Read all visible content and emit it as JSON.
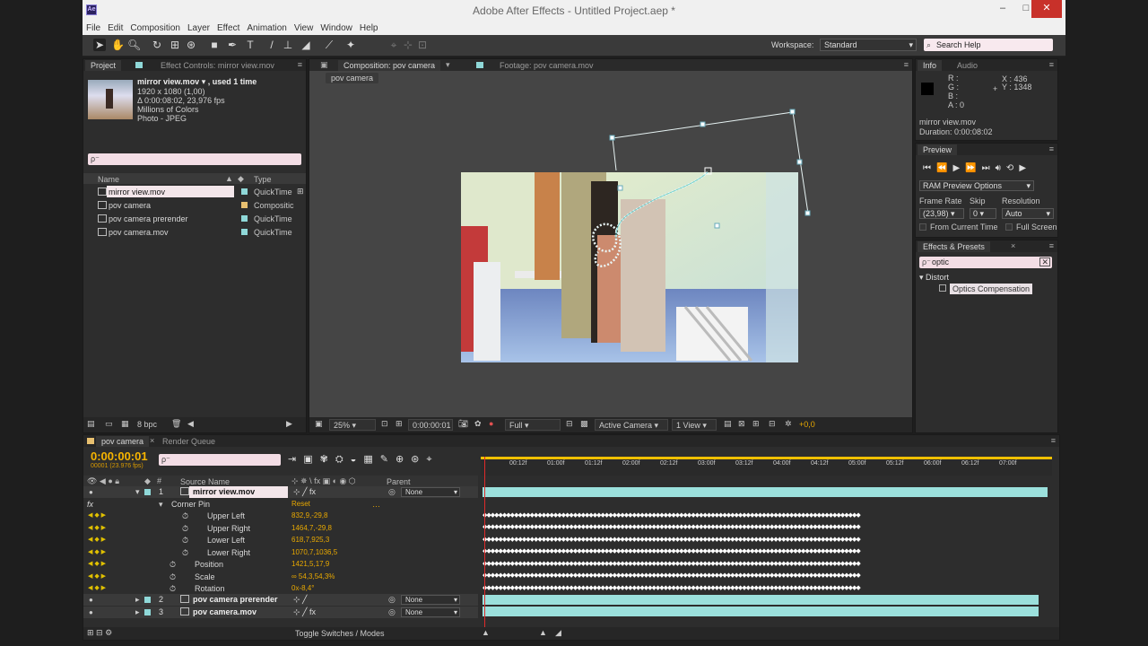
{
  "window": {
    "title": "Adobe After Effects - Untitled Project.aep *",
    "minimize": "–",
    "maximize": "□",
    "close": "✕",
    "logo": "Ae"
  },
  "menu": [
    "File",
    "Edit",
    "Composition",
    "Layer",
    "Effect",
    "Animation",
    "View",
    "Window",
    "Help"
  ],
  "toolbar": {
    "tools": [
      "selection-tool-icon",
      "hand-tool-icon",
      "zoom-tool-icon",
      "rotate-tool-icon",
      "camera-orbit-icon",
      "pan-behind-icon",
      "rectangle-tool-icon",
      "pen-tool-icon",
      "type-tool-icon",
      "brush-tool-icon",
      "clone-stamp-icon",
      "eraser-icon",
      "roto-brush-icon",
      "puppet-pin-icon"
    ],
    "workspace_label": "Workspace:",
    "workspace_value": "Standard",
    "search_placeholder": "Search Help"
  },
  "project": {
    "tabs": [
      "Project",
      "Effect Controls: mirror view.mov"
    ],
    "selected_name": "mirror view.mov ▾ , used 1 time",
    "info_lines": [
      "1920 x 1080 (1,00)",
      "Δ 0:00:08:02, 23,976 fps",
      "Millions of Colors",
      "Photo - JPEG"
    ],
    "search_value": "ρ⁻",
    "col_name": "Name",
    "col_type": "Type",
    "items": [
      {
        "name": "mirror view.mov",
        "type": "QuickTime",
        "color": "#8fd8d8",
        "selected": true
      },
      {
        "name": "pov camera",
        "type": "Compositic",
        "color": "#e8c070",
        "selected": false
      },
      {
        "name": "pov camera prerender",
        "type": "QuickTime",
        "color": "#8fd8d8",
        "selected": false
      },
      {
        "name": "pov camera.mov",
        "type": "QuickTime",
        "color": "#8fd8d8",
        "selected": false
      }
    ],
    "bpc": "8 bpc"
  },
  "viewer": {
    "tab_comp": "Composition: pov camera",
    "tab_footage": "Footage: pov camera.mov",
    "crumb": "pov camera",
    "zoom": "25%",
    "timecode": "0:00:00:01",
    "resolution": "Full",
    "camera": "Active Camera",
    "views": "1 View",
    "exposure": "+0,0"
  },
  "info_panel": {
    "tabs": [
      "Info",
      "Audio"
    ],
    "r": "R :",
    "g": "G :",
    "b": "B :",
    "a": "A : 0",
    "x": "X : 436",
    "y": "Y : 1348",
    "clip": "mirror view.mov",
    "duration": "Duration: 0:00:08:02"
  },
  "preview_panel": {
    "title": "Preview",
    "ram_options": "RAM Preview Options",
    "frame_rate_label": "Frame Rate",
    "skip_label": "Skip",
    "resolution_label": "Resolution",
    "frame_rate": "(23,98)",
    "skip": "0",
    "resolution": "Auto",
    "from_current": "From Current Time",
    "full_screen": "Full Screen"
  },
  "effects_panel": {
    "title": "Effects & Presets",
    "search": "optic",
    "category": "Distort",
    "effect": "Optics Compensation"
  },
  "timeline": {
    "tabs": [
      "pov camera",
      "Render Queue"
    ],
    "time": "0:00:00:01",
    "fps": "00001 (23.976 fps)",
    "col_source": "Source Name",
    "col_parent": "Parent",
    "ruler": [
      "00:12f",
      "01:00f",
      "01:12f",
      "02:00f",
      "02:12f",
      "03:00f",
      "03:12f",
      "04:00f",
      "04:12f",
      "05:00f",
      "05:12f",
      "06:00f",
      "06:12f",
      "07:00f"
    ],
    "layers": [
      {
        "num": "1",
        "name": "mirror view.mov",
        "parent": "None"
      },
      {
        "num": "2",
        "name": "pov camera prerender",
        "parent": "None"
      },
      {
        "num": "3",
        "name": "pov camera.mov",
        "parent": "None"
      }
    ],
    "effect_name": "Corner Pin",
    "effect_reset": "Reset",
    "props": [
      {
        "name": "Upper Left",
        "value": "832,9,-29,8"
      },
      {
        "name": "Upper Right",
        "value": "1464,7,-29,8"
      },
      {
        "name": "Lower Left",
        "value": "618,7,925,3"
      },
      {
        "name": "Lower Right",
        "value": "1070,7,1036,5"
      },
      {
        "name": "Position",
        "value": "1421,5,17,9"
      },
      {
        "name": "Scale",
        "value": "∞ 54,3,54,3%"
      },
      {
        "name": "Rotation",
        "value": "0x-8,4°"
      }
    ],
    "footer": "Toggle Switches / Modes"
  }
}
